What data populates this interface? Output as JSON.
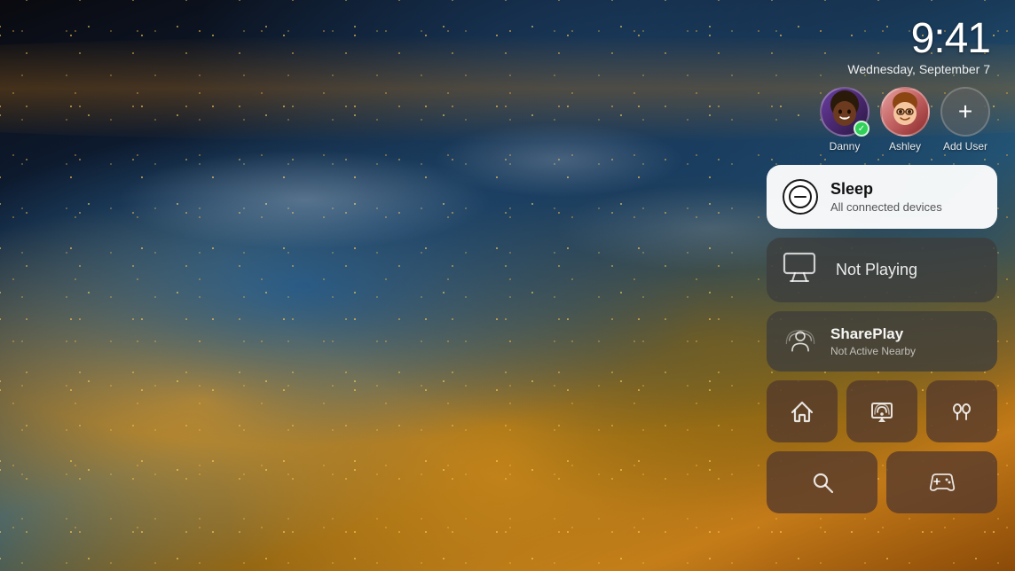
{
  "clock": {
    "time": "9:41",
    "date": "Wednesday, September 7"
  },
  "users": [
    {
      "name": "Danny",
      "emoji": "👩🏾",
      "active": true
    },
    {
      "name": "Ashley",
      "emoji": "🧑",
      "active": false
    },
    {
      "name": "Add User",
      "emoji": "+",
      "active": false
    }
  ],
  "sleep_card": {
    "title": "Sleep",
    "subtitle": "All connected devices"
  },
  "now_playing_card": {
    "label": "Not Playing"
  },
  "shareplay_card": {
    "title": "SharePlay",
    "subtitle": "Not Active Nearby"
  },
  "grid_buttons": [
    {
      "icon": "🏠",
      "label": "home"
    },
    {
      "icon": "📡",
      "label": "airplay"
    },
    {
      "icon": "🎧",
      "label": "airpods"
    },
    {
      "icon": "🔍",
      "label": "search"
    },
    {
      "icon": "🎮",
      "label": "game-controller"
    }
  ]
}
